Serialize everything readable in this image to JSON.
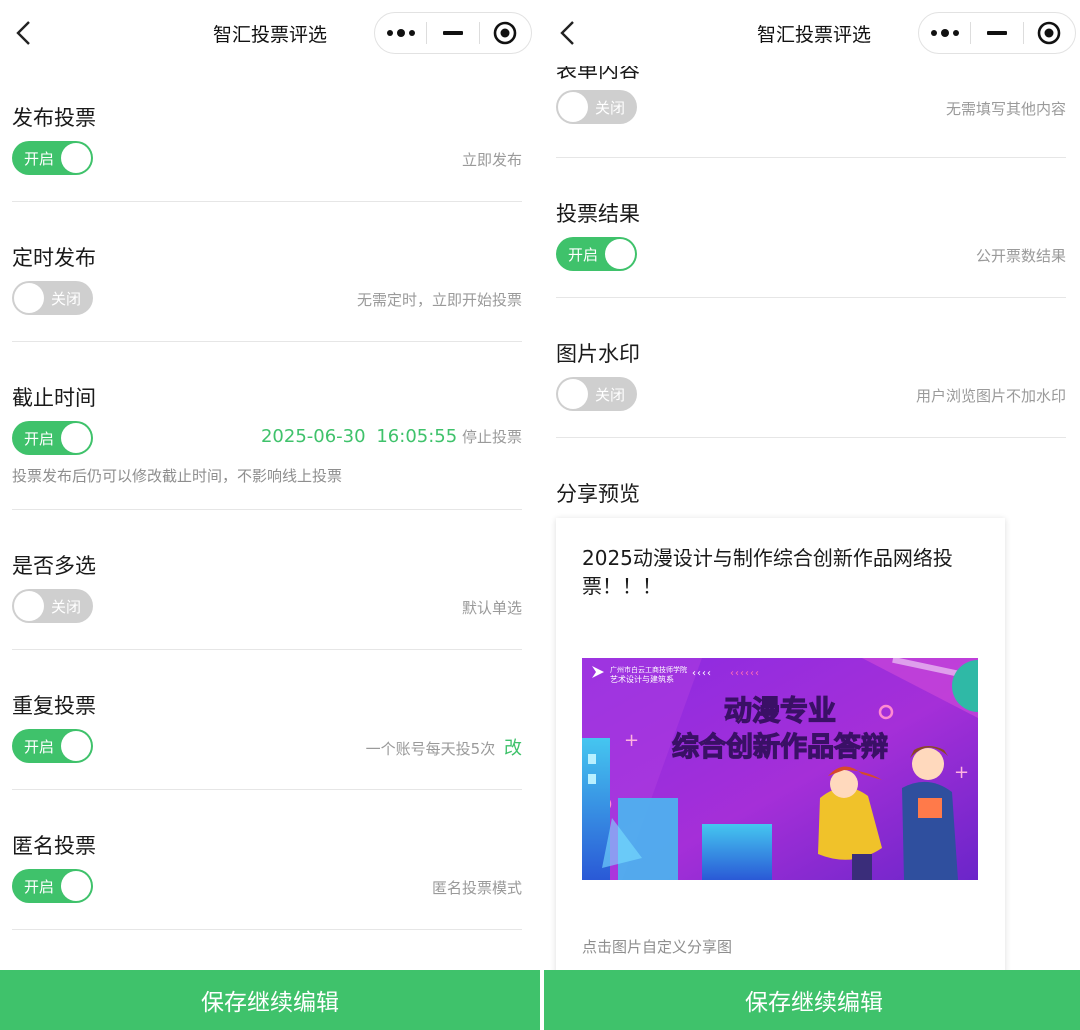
{
  "nav": {
    "title": "智汇投票评选"
  },
  "left": {
    "rows": [
      {
        "title": "发布投票",
        "switch": "开启",
        "on": true,
        "desc": "立即发布"
      },
      {
        "title": "定时发布",
        "switch": "关闭",
        "on": false,
        "desc": "无需定时，立即开始投票"
      },
      {
        "title": "截止时间",
        "switch": "开启",
        "on": true,
        "date": "2025-06-30",
        "time": "16:05:55",
        "desc": "停止投票",
        "note": "投票发布后仍可以修改截止时间，不影响线上投票"
      },
      {
        "title": "是否多选",
        "switch": "关闭",
        "on": false,
        "desc": "默认单选"
      },
      {
        "title": "重复投票",
        "switch": "开启",
        "on": true,
        "desc": "一个账号每天投5次",
        "link": "改"
      },
      {
        "title": "匿名投票",
        "switch": "开启",
        "on": true,
        "desc": "匿名投票模式"
      }
    ]
  },
  "right": {
    "rows": [
      {
        "title": "表单内容",
        "switch": "关闭",
        "on": false,
        "desc": "无需填写其他内容"
      },
      {
        "title": "投票结果",
        "switch": "开启",
        "on": true,
        "desc": "公开票数结果"
      },
      {
        "title": "图片水印",
        "switch": "关闭",
        "on": false,
        "desc": "用户浏览图片不加水印"
      }
    ],
    "share": {
      "title": "分享预览",
      "card_title": "2025动漫设计与制作综合创新作品网络投票！！！",
      "poster": {
        "school_line1": "广州市白云工商技师学院",
        "school_line2": "艺术设计与建筑系",
        "headline1": "动漫专业",
        "headline2": "综合创新作品答辩"
      },
      "note": "点击图片自定义分享图"
    }
  },
  "footer": {
    "label": "保存继续编辑"
  },
  "colors": {
    "accent": "#3fc26b",
    "off": "#cfcfcf"
  }
}
